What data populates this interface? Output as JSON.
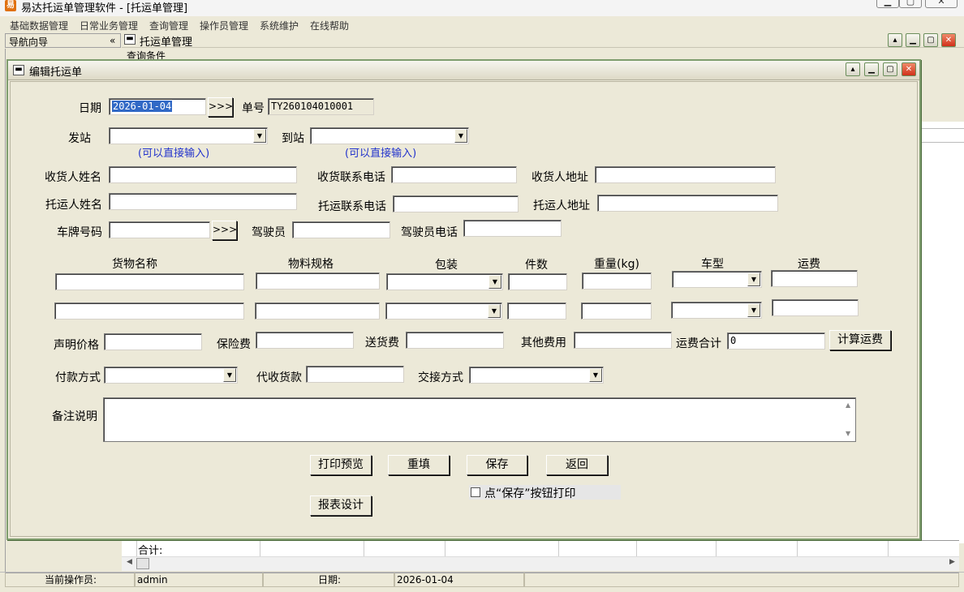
{
  "app": {
    "icon_glyph": "易",
    "title": "易达托运单管理软件 - [托运单管理]"
  },
  "menu": [
    "基础数据管理",
    "日常业务管理",
    "查询管理",
    "操作员管理",
    "系统维护",
    "在线帮助"
  ],
  "nav": {
    "title": "导航向导",
    "collapse_glyph": "«"
  },
  "manager_window": {
    "title": "托运单管理",
    "query_label": "查询条件"
  },
  "dialog": {
    "title": "编辑托运单",
    "date_label": "日期",
    "date_value": "2026-01-04",
    "pick_button": ">>>",
    "order_no_label": "单号",
    "order_no_value": "TY260104010001",
    "from_station_label": "发站",
    "to_station_label": "到站",
    "direct_input_hint": "(可以直接输入)",
    "receiver_name_label": "收货人姓名",
    "receiver_phone_label": "收货联系电话",
    "receiver_address_label": "收货人地址",
    "shipper_name_label": "托运人姓名",
    "shipper_phone_label": "托运联系电话",
    "shipper_address_label": "托运人地址",
    "plate_label": "车牌号码",
    "driver_label": "驾驶员",
    "driver_phone_label": "驾驶员电话",
    "goods_headers": {
      "name": "货物名称",
      "spec": "物料规格",
      "package": "包装",
      "count": "件数",
      "weight": "重量(kg)",
      "vehicle_type": "车型",
      "freight": "运费"
    },
    "declared_value_label": "声明价格",
    "insurance_label": "保险费",
    "delivery_fee_label": "送货费",
    "other_fee_label": "其他费用",
    "freight_total_label": "运费合计",
    "freight_total_value": "0",
    "calc_button": "计算运费",
    "payment_label": "付款方式",
    "cod_label": "代收货款",
    "handover_label": "交接方式",
    "remarks_label": "备注说明",
    "buttons": {
      "print_preview": "打印预览",
      "reset": "重填",
      "save": "保存",
      "back": "返回",
      "report_design": "报表设计"
    },
    "print_on_save_label": "点“保存”按钮打印"
  },
  "grid": {
    "total_label": "合计:"
  },
  "status": {
    "operator_label": "当前操作员:",
    "operator_value": "admin",
    "date_label": "日期:",
    "date_value": "2026-01-04"
  },
  "colors": {
    "window_bg": "#ece9d8",
    "selection": "#3169c6",
    "hint_text": "#2233cc",
    "close_button": "#d0301a",
    "dialog_border": "#7f9d6e"
  }
}
